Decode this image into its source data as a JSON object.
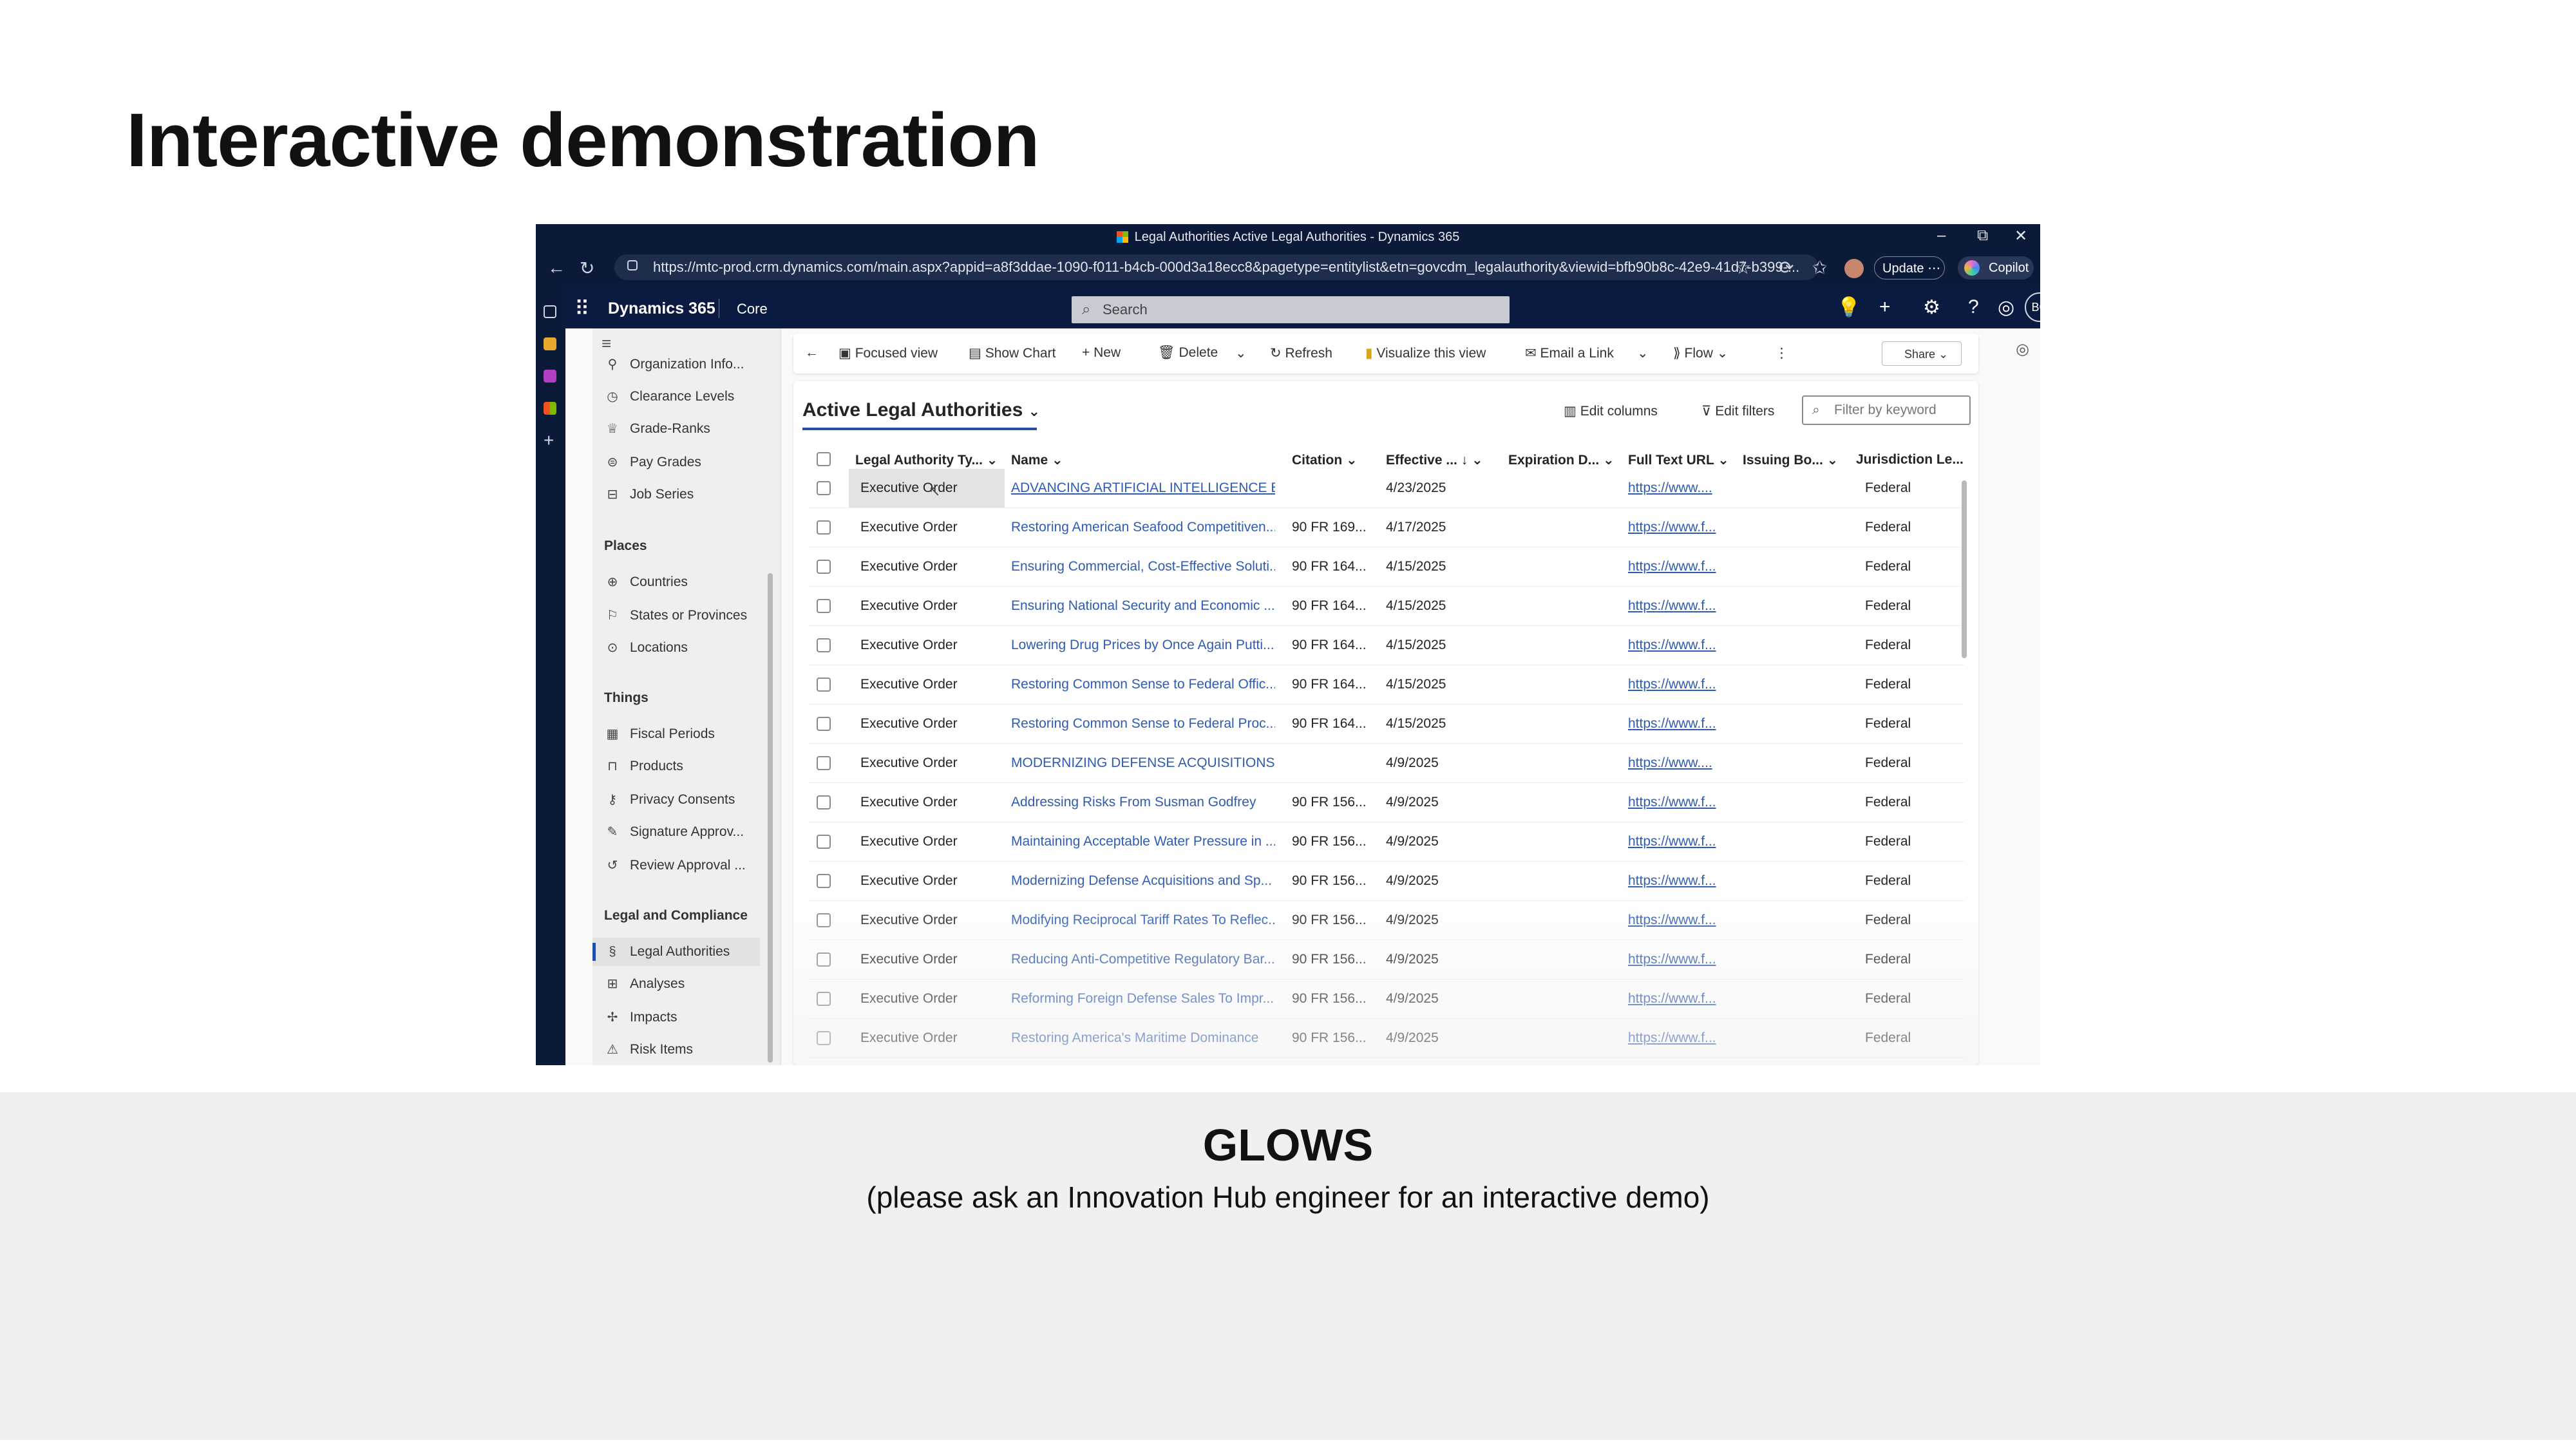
{
  "slide": {
    "title": "Interactive demonstration",
    "caption_title": "GLOWS",
    "caption_sub": "(please ask an Innovation Hub engineer for an interactive demo)"
  },
  "window": {
    "title": "Legal Authorities Active Legal Authorities - Dynamics 365",
    "controls": [
      "–",
      "⧉",
      "✕"
    ]
  },
  "browser": {
    "url": "https://mtc-prod.crm.dynamics.com/main.aspx?appid=a8f3ddae-1090-f011-b4cb-000d3a18ecc8&pagetype=entitylist&etn=govcdm_legalauthority&viewid=bfb90b8c-42e9-41d7-b399-...",
    "update_label": "Update",
    "update_more": "⋯",
    "copilot_label": "Copilot"
  },
  "app": {
    "brand": "Dynamics 365",
    "area": "Core",
    "search_placeholder": "Search",
    "user_initials": "BC"
  },
  "sidebar": {
    "top_items": [
      {
        "label": "Organization Info...",
        "icon": "org-icon"
      },
      {
        "label": "Clearance Levels",
        "icon": "clearance-icon"
      },
      {
        "label": "Grade-Ranks",
        "icon": "trophy-icon"
      },
      {
        "label": "Pay Grades",
        "icon": "money-icon"
      },
      {
        "label": "Job Series",
        "icon": "job-icon"
      }
    ],
    "groups": [
      {
        "label": "Places",
        "items": [
          {
            "label": "Countries",
            "icon": "globe-icon"
          },
          {
            "label": "States or Provinces",
            "icon": "flag-icon"
          },
          {
            "label": "Locations",
            "icon": "pin-icon"
          }
        ]
      },
      {
        "label": "Things",
        "items": [
          {
            "label": "Fiscal Periods",
            "icon": "calendar-icon"
          },
          {
            "label": "Products",
            "icon": "box-icon"
          },
          {
            "label": "Privacy Consents",
            "icon": "key-icon"
          },
          {
            "label": "Signature Approv...",
            "icon": "pen-icon"
          },
          {
            "label": "Review Approval ...",
            "icon": "review-icon"
          }
        ]
      },
      {
        "label": "Legal and Compliance",
        "items": [
          {
            "label": "Legal Authorities",
            "icon": "section-icon"
          },
          {
            "label": "Analyses",
            "icon": "analysis-icon"
          },
          {
            "label": "Impacts",
            "icon": "impact-icon"
          },
          {
            "label": "Risk Items",
            "icon": "warning-icon"
          }
        ]
      }
    ]
  },
  "commands": {
    "focused_view": "Focused view",
    "show_chart": "Show Chart",
    "new": "New",
    "delete": "Delete",
    "refresh": "Refresh",
    "visualize": "Visualize this view",
    "email_link": "Email a Link",
    "flow": "Flow",
    "share": "Share"
  },
  "view": {
    "title": "Active Legal Authorities",
    "edit_columns": "Edit columns",
    "edit_filters": "Edit filters",
    "filter_placeholder": "Filter by keyword"
  },
  "columns": [
    "Legal Authority Ty...",
    "Name",
    "Citation",
    "Effective ...",
    "Expiration D...",
    "Full Text URL",
    "Issuing Bo...",
    "Jurisdiction Le..."
  ],
  "rows": [
    {
      "type": "Executive Order",
      "name": "ADVANCING ARTIFICIAL INTELLIGENCE ED...",
      "citation": "",
      "effective": "4/23/2025",
      "url": "https://www....",
      "jurisdiction": "Federal"
    },
    {
      "type": "Executive Order",
      "name": "Restoring American Seafood Competitiven...",
      "citation": "90 FR 169...",
      "effective": "4/17/2025",
      "url": "https://www.f...",
      "jurisdiction": "Federal"
    },
    {
      "type": "Executive Order",
      "name": "Ensuring Commercial, Cost-Effective Soluti...",
      "citation": "90 FR 164...",
      "effective": "4/15/2025",
      "url": "https://www.f...",
      "jurisdiction": "Federal"
    },
    {
      "type": "Executive Order",
      "name": "Ensuring National Security and Economic ...",
      "citation": "90 FR 164...",
      "effective": "4/15/2025",
      "url": "https://www.f...",
      "jurisdiction": "Federal"
    },
    {
      "type": "Executive Order",
      "name": "Lowering Drug Prices by Once Again Putti...",
      "citation": "90 FR 164...",
      "effective": "4/15/2025",
      "url": "https://www.f...",
      "jurisdiction": "Federal"
    },
    {
      "type": "Executive Order",
      "name": "Restoring Common Sense to Federal Offic...",
      "citation": "90 FR 164...",
      "effective": "4/15/2025",
      "url": "https://www.f...",
      "jurisdiction": "Federal"
    },
    {
      "type": "Executive Order",
      "name": "Restoring Common Sense to Federal Proc...",
      "citation": "90 FR 164...",
      "effective": "4/15/2025",
      "url": "https://www.f...",
      "jurisdiction": "Federal"
    },
    {
      "type": "Executive Order",
      "name": "MODERNIZING DEFENSE ACQUISITIONS ...",
      "citation": "",
      "effective": "4/9/2025",
      "url": "https://www....",
      "jurisdiction": "Federal"
    },
    {
      "type": "Executive Order",
      "name": "Addressing Risks From Susman Godfrey",
      "citation": "90 FR 156...",
      "effective": "4/9/2025",
      "url": "https://www.f...",
      "jurisdiction": "Federal"
    },
    {
      "type": "Executive Order",
      "name": "Maintaining Acceptable Water Pressure in ...",
      "citation": "90 FR 156...",
      "effective": "4/9/2025",
      "url": "https://www.f...",
      "jurisdiction": "Federal"
    },
    {
      "type": "Executive Order",
      "name": "Modernizing Defense Acquisitions and Sp...",
      "citation": "90 FR 156...",
      "effective": "4/9/2025",
      "url": "https://www.f...",
      "jurisdiction": "Federal"
    },
    {
      "type": "Executive Order",
      "name": "Modifying Reciprocal Tariff Rates To Reflec...",
      "citation": "90 FR 156...",
      "effective": "4/9/2025",
      "url": "https://www.f...",
      "jurisdiction": "Federal"
    },
    {
      "type": "Executive Order",
      "name": "Reducing Anti-Competitive Regulatory Bar...",
      "citation": "90 FR 156...",
      "effective": "4/9/2025",
      "url": "https://www.f...",
      "jurisdiction": "Federal"
    },
    {
      "type": "Executive Order",
      "name": "Reforming Foreign Defense Sales To Impr...",
      "citation": "90 FR 156...",
      "effective": "4/9/2025",
      "url": "https://www.f...",
      "jurisdiction": "Federal"
    },
    {
      "type": "Executive Order",
      "name": "Restoring America's Maritime Dominance",
      "citation": "90 FR 156...",
      "effective": "4/9/2025",
      "url": "https://www.f...",
      "jurisdiction": "Federal"
    }
  ],
  "colors": {
    "titlebar": "#0c1a3a",
    "nav": "#0a1a40",
    "link": "#2f5bb1",
    "accent": "#1f4fa8"
  }
}
